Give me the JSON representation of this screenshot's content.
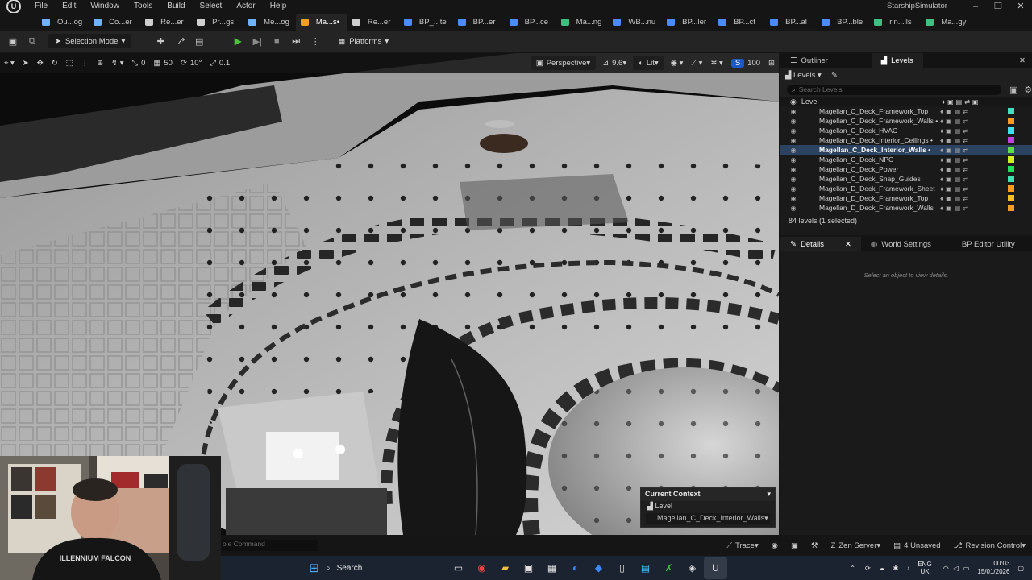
{
  "menubar": {
    "items": [
      "File",
      "Edit",
      "Window",
      "Tools",
      "Build",
      "Select",
      "Actor",
      "Help"
    ],
    "project_name": "StarshipSimulator"
  },
  "tabs": [
    {
      "label": "Ou...og",
      "color": "#6fb2ff",
      "active": false
    },
    {
      "label": "Co...er",
      "color": "#6fb2ff",
      "active": false
    },
    {
      "label": "Re...er",
      "color": "#cfcfcf",
      "active": false
    },
    {
      "label": "Pr...gs",
      "color": "#cfcfcf",
      "active": false
    },
    {
      "label": "Me...og",
      "color": "#6fb2ff",
      "active": false
    },
    {
      "label": "Ma...s",
      "color": "#f0a020",
      "active": true,
      "modified": "•"
    },
    {
      "label": "Re...er",
      "color": "#cfcfcf",
      "active": false
    },
    {
      "label": "BP_...te",
      "color": "#4a8cff",
      "active": false
    },
    {
      "label": "BP...er",
      "color": "#4a8cff",
      "active": false
    },
    {
      "label": "BP...ce",
      "color": "#4a8cff",
      "active": false
    },
    {
      "label": "Ma...ng",
      "color": "#40c080",
      "active": false
    },
    {
      "label": "WB...nu",
      "color": "#4a8cff",
      "active": false
    },
    {
      "label": "BP...ler",
      "color": "#4a8cff",
      "active": false
    },
    {
      "label": "BP...ct",
      "color": "#4a8cff",
      "active": false
    },
    {
      "label": "BP...al",
      "color": "#4a8cff",
      "active": false
    },
    {
      "label": "BP...ble",
      "color": "#4a8cff",
      "active": false
    },
    {
      "label": "rin...lls",
      "color": "#40c080",
      "active": false
    },
    {
      "label": "Ma...gy",
      "color": "#40c080",
      "active": false
    }
  ],
  "toolbar": {
    "mode": "Selection Mode",
    "platforms": "Platforms"
  },
  "viewport_toolbar": {
    "grid_snap": "0",
    "grid_value": "50",
    "rot_snap": "10°",
    "scale_snap": "0.1",
    "view": "Perspective",
    "fov": "9.6",
    "lighting": "Lit",
    "camera_speed": "100"
  },
  "context_popup": {
    "title": "Current Context",
    "level_label": "Level",
    "value": "Magellan_C_Deck_Interior_Walls"
  },
  "outliner": {
    "tab_outliner": "Outliner",
    "tab_levels": "Levels",
    "levels_dropdown": "Levels",
    "search_placeholder": "Search Levels",
    "column_level": "Level",
    "rows": [
      {
        "name": "Magellan_C_Deck_Framework_Top",
        "color": "#40e0c0",
        "selected": false
      },
      {
        "name": "Magellan_C_Deck_Framework_Walls •",
        "color": "#ff9a20",
        "selected": false
      },
      {
        "name": "Magellan_C_Deck_HVAC",
        "color": "#40e0e8",
        "selected": false
      },
      {
        "name": "Magellan_C_Deck_Interior_Ceilings •",
        "color": "#c040e0",
        "selected": false
      },
      {
        "name": "Magellan_C_Deck_Interior_Walls •",
        "color": "#60e040",
        "selected": true
      },
      {
        "name": "Magellan_C_Deck_NPC",
        "color": "#d0f020",
        "selected": false
      },
      {
        "name": "Magellan_C_Deck_Power",
        "color": "#20e060",
        "selected": false
      },
      {
        "name": "Magellan_C_Deck_Snap_Guides",
        "color": "#40e0b0",
        "selected": false
      },
      {
        "name": "Magellan_D_Deck_Framework_Sheet",
        "color": "#ff9a20",
        "selected": false
      },
      {
        "name": "Magellan_D_Deck_Framework_Top",
        "color": "#f0c020",
        "selected": false
      },
      {
        "name": "Magellan_D_Deck_Framework_Walls",
        "color": "#f0a020",
        "selected": false
      }
    ],
    "level_count": "84 levels (1 selected)"
  },
  "details": {
    "tab_details": "Details",
    "tab_world": "World Settings",
    "tab_bp": "BP Editor Utility",
    "empty_text": "Select an object to view details."
  },
  "statusbar": {
    "cmd_placeholder": "ole Command",
    "trace": "Trace",
    "zen": "Zen Server",
    "unsaved": "4 Unsaved",
    "revision": "Revision Control"
  },
  "taskbar": {
    "search": "Search",
    "lang": "ENG",
    "region": "UK",
    "time": "00:03",
    "date": "15/01/2026"
  }
}
